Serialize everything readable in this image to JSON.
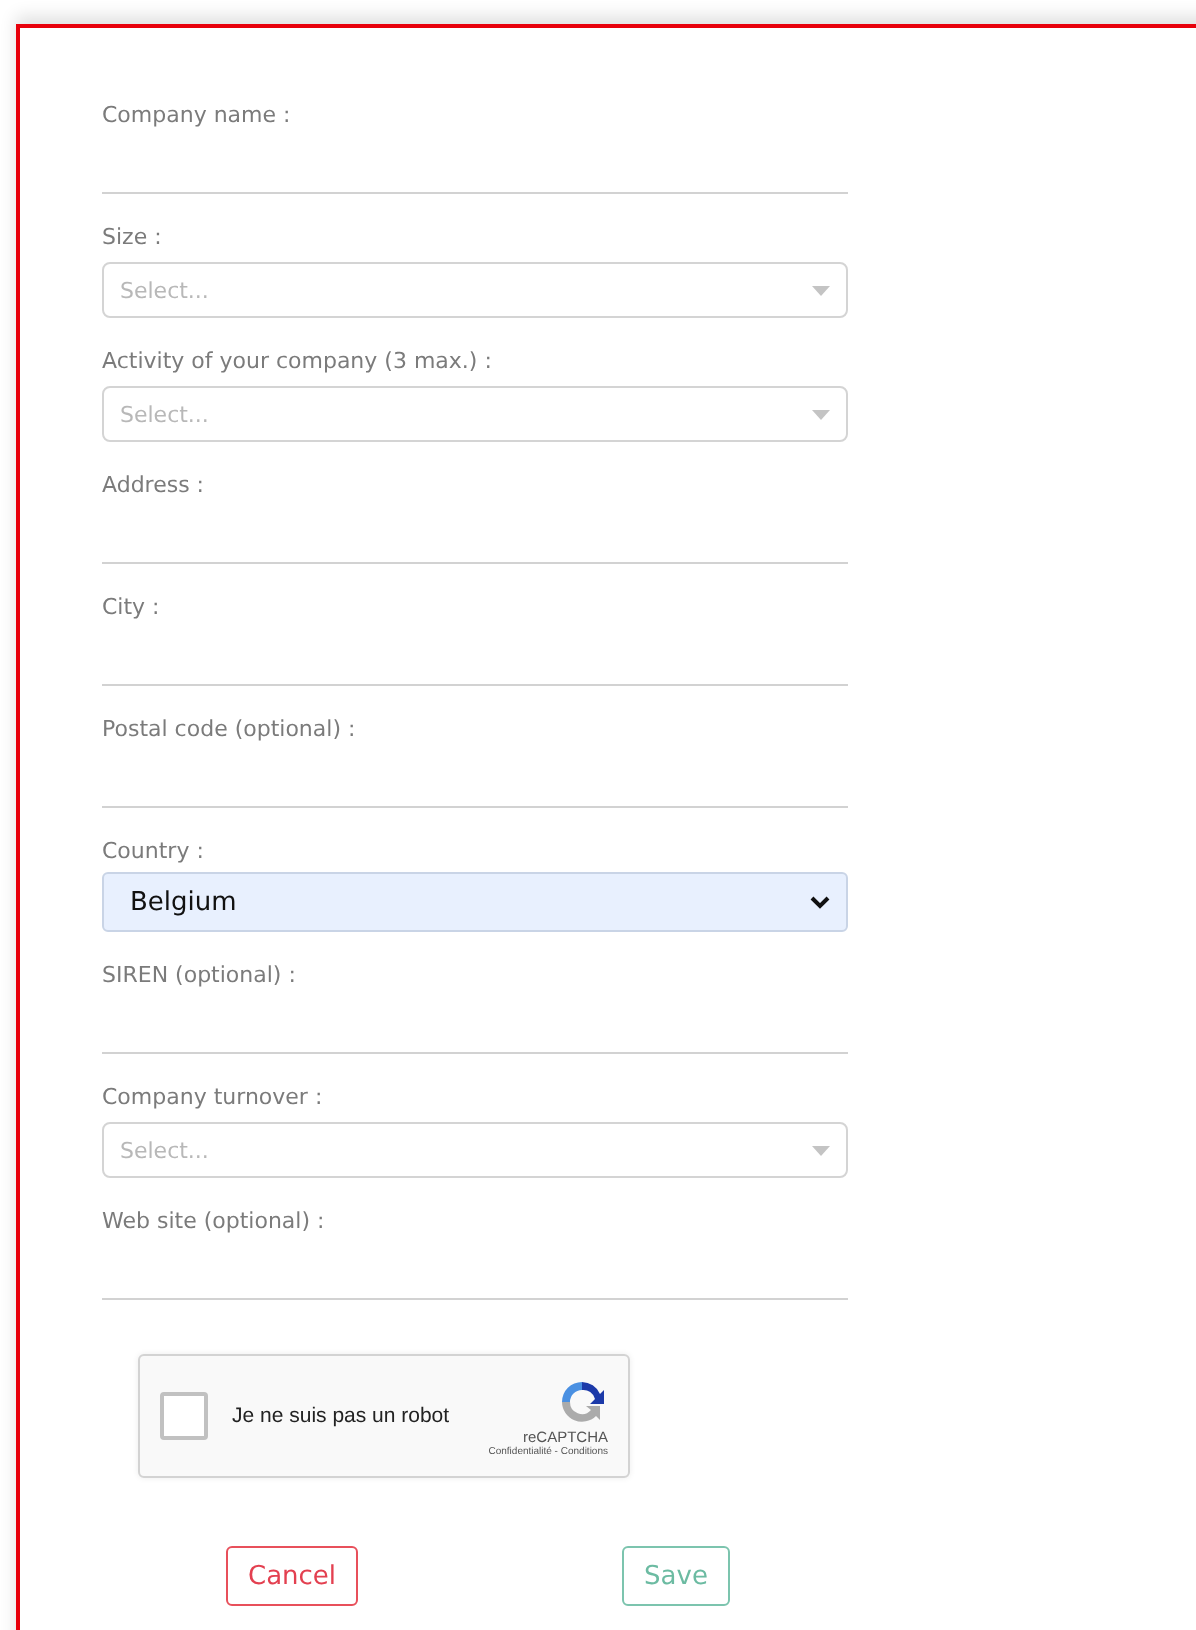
{
  "fields": [
    {
      "kind": "text",
      "label": "Company name :"
    },
    {
      "kind": "select",
      "label": "Size :",
      "placeholder": "Select..."
    },
    {
      "kind": "select",
      "label": "Activity of your company (3 max.) :",
      "placeholder": "Select..."
    },
    {
      "kind": "text",
      "label": "Address :"
    },
    {
      "kind": "text",
      "label": "City :"
    },
    {
      "kind": "text",
      "label": "Postal code (optional) :"
    },
    {
      "kind": "native",
      "label": "Country :",
      "value": "Belgium"
    },
    {
      "kind": "text",
      "label": "SIREN (optional) :"
    },
    {
      "kind": "select",
      "label": "Company turnover :",
      "placeholder": "Select..."
    },
    {
      "kind": "text",
      "label": "Web site (optional) :"
    }
  ],
  "captcha": {
    "checked": false,
    "label": "Je ne suis pas un robot",
    "brand": "reCAPTCHA",
    "links": "Confidentialité - Conditions"
  },
  "buttons": [
    {
      "kind": "cancel",
      "label": "Cancel"
    },
    {
      "kind": "save",
      "label": "Save"
    }
  ]
}
